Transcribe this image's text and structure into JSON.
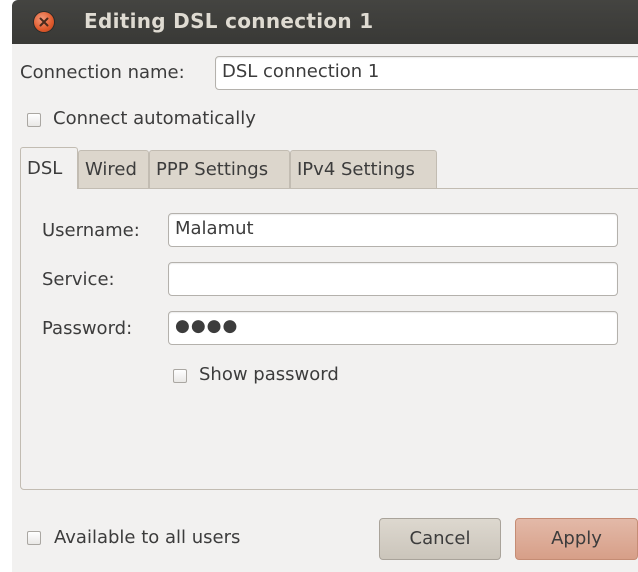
{
  "window": {
    "title": "Editing DSL connection 1"
  },
  "general": {
    "connection_name_label": "Connection name:",
    "connection_name_value": "DSL connection 1",
    "connect_auto_label": "Connect automatically"
  },
  "tabs": [
    {
      "label": "DSL"
    },
    {
      "label": "Wired"
    },
    {
      "label": "PPP Settings"
    },
    {
      "label": "IPv4 Settings"
    }
  ],
  "dsl": {
    "username_label": "Username:",
    "username_value": "Malamut",
    "service_label": "Service:",
    "service_value": "",
    "password_label": "Password:",
    "password_value": "●●●●",
    "show_password_label": "Show password"
  },
  "footer": {
    "all_users_label": "Available to all users",
    "cancel_label": "Cancel",
    "apply_label": "Apply"
  },
  "colors": {
    "titlebar": "#3c3b37",
    "close_button": "#e05a2c",
    "window_bg": "#f2f1f0",
    "apply_button": "#dca38d"
  }
}
